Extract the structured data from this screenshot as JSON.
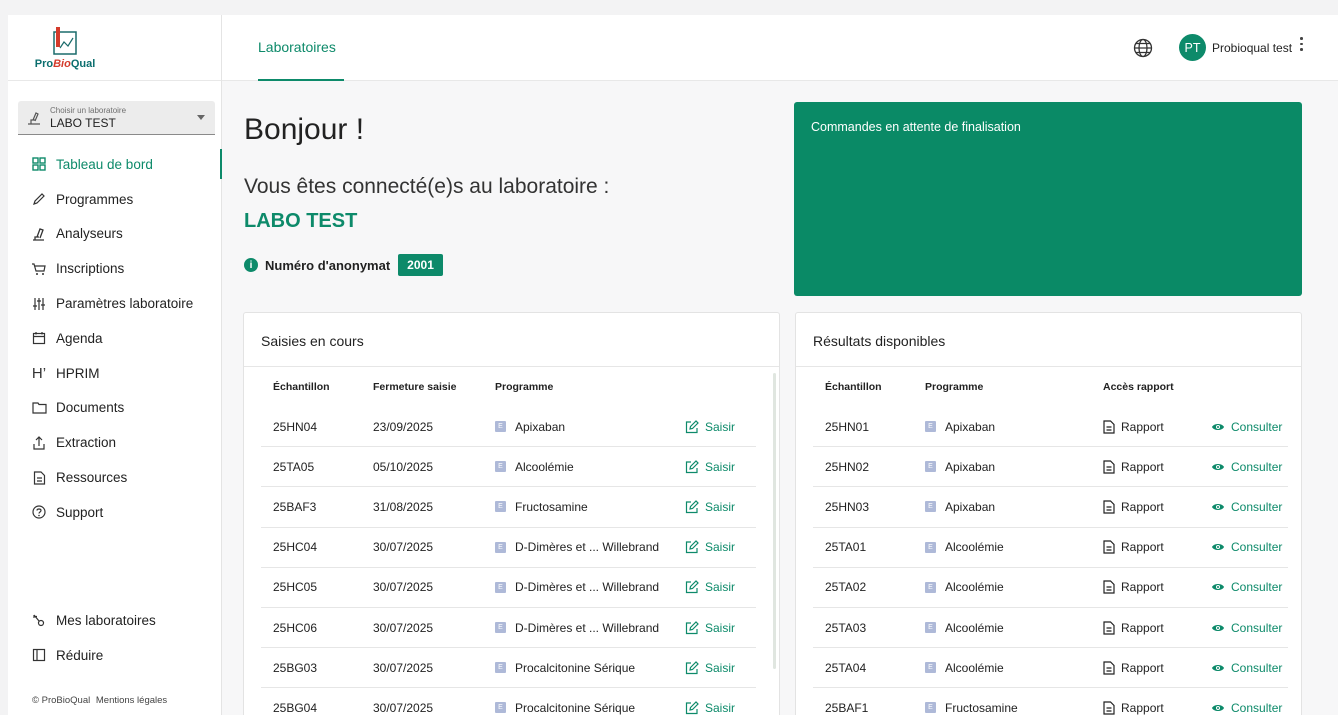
{
  "app": {
    "logo_text_pro": "Pro",
    "logo_text_bio": "Bio",
    "logo_text_qual": "Qual"
  },
  "lab_select": {
    "label": "Choisir un laboratoire",
    "value": "LABO TEST"
  },
  "sidebar": {
    "items": [
      {
        "label": "Tableau de bord",
        "icon": "dashboard-grid-icon",
        "active": true
      },
      {
        "label": "Programmes",
        "icon": "pen-icon"
      },
      {
        "label": "Analyseurs",
        "icon": "microscope-icon"
      },
      {
        "label": "Inscriptions",
        "icon": "cart-icon"
      },
      {
        "label": "Paramètres laboratoire",
        "icon": "sliders-icon"
      },
      {
        "label": "Agenda",
        "icon": "calendar-icon"
      },
      {
        "label": "HPRIM",
        "icon": "hprim-icon"
      },
      {
        "label": "Documents",
        "icon": "folder-icon"
      },
      {
        "label": "Extraction",
        "icon": "upload-icon"
      },
      {
        "label": "Ressources",
        "icon": "document-icon"
      },
      {
        "label": "Support",
        "icon": "help-icon"
      }
    ],
    "bottom": [
      {
        "label": "Mes laboratoires",
        "icon": "key-icon"
      },
      {
        "label": "Réduire",
        "icon": "collapse-icon"
      }
    ],
    "footer_copyright": "© ProBioQual",
    "footer_legal": "Mentions légales"
  },
  "topbar": {
    "tab": "Laboratoires",
    "avatar_initials": "PT",
    "user_name": "Probioqual test"
  },
  "main": {
    "greeting": "Bonjour !",
    "connected_text": "Vous êtes connecté(e)s au laboratoire :",
    "lab_name": "LABO TEST",
    "anon_label": "Numéro d'anonymat",
    "anon_number": "2001",
    "pending_title": "Commandes en attente de finalisation"
  },
  "saisies": {
    "title": "Saisies en cours",
    "headers": [
      "Échantillon",
      "Fermeture saisie",
      "Programme"
    ],
    "badge": "E",
    "action_label": "Saisir",
    "rows": [
      {
        "sample": "25HN04",
        "date": "23/09/2025",
        "program": "Apixaban"
      },
      {
        "sample": "25TA05",
        "date": "05/10/2025",
        "program": "Alcoolémie"
      },
      {
        "sample": "25BAF3",
        "date": "31/08/2025",
        "program": "Fructosamine"
      },
      {
        "sample": "25HC04",
        "date": "30/07/2025",
        "program": "D-Dimères et ... Willebrand"
      },
      {
        "sample": "25HC05",
        "date": "30/07/2025",
        "program": "D-Dimères et ... Willebrand"
      },
      {
        "sample": "25HC06",
        "date": "30/07/2025",
        "program": "D-Dimères et ... Willebrand"
      },
      {
        "sample": "25BG03",
        "date": "30/07/2025",
        "program": "Procalcitonine Sérique"
      },
      {
        "sample": "25BG04",
        "date": "30/07/2025",
        "program": "Procalcitonine Sérique"
      }
    ]
  },
  "resultats": {
    "title": "Résultats disponibles",
    "headers": [
      "Échantillon",
      "Programme",
      "Accès rapport"
    ],
    "badge": "E",
    "report_label": "Rapport",
    "consult_label": "Consulter",
    "rows": [
      {
        "sample": "25HN01",
        "program": "Apixaban"
      },
      {
        "sample": "25HN02",
        "program": "Apixaban"
      },
      {
        "sample": "25HN03",
        "program": "Apixaban"
      },
      {
        "sample": "25TA01",
        "program": "Alcoolémie"
      },
      {
        "sample": "25TA02",
        "program": "Alcoolémie"
      },
      {
        "sample": "25TA03",
        "program": "Alcoolémie"
      },
      {
        "sample": "25TA04",
        "program": "Alcoolémie"
      },
      {
        "sample": "25BAF1",
        "program": "Fructosamine"
      }
    ]
  },
  "colors": {
    "brand_green": "#0d8a6a",
    "card_green": "#0a8a66",
    "badge_blue": "#aeb9d8"
  }
}
